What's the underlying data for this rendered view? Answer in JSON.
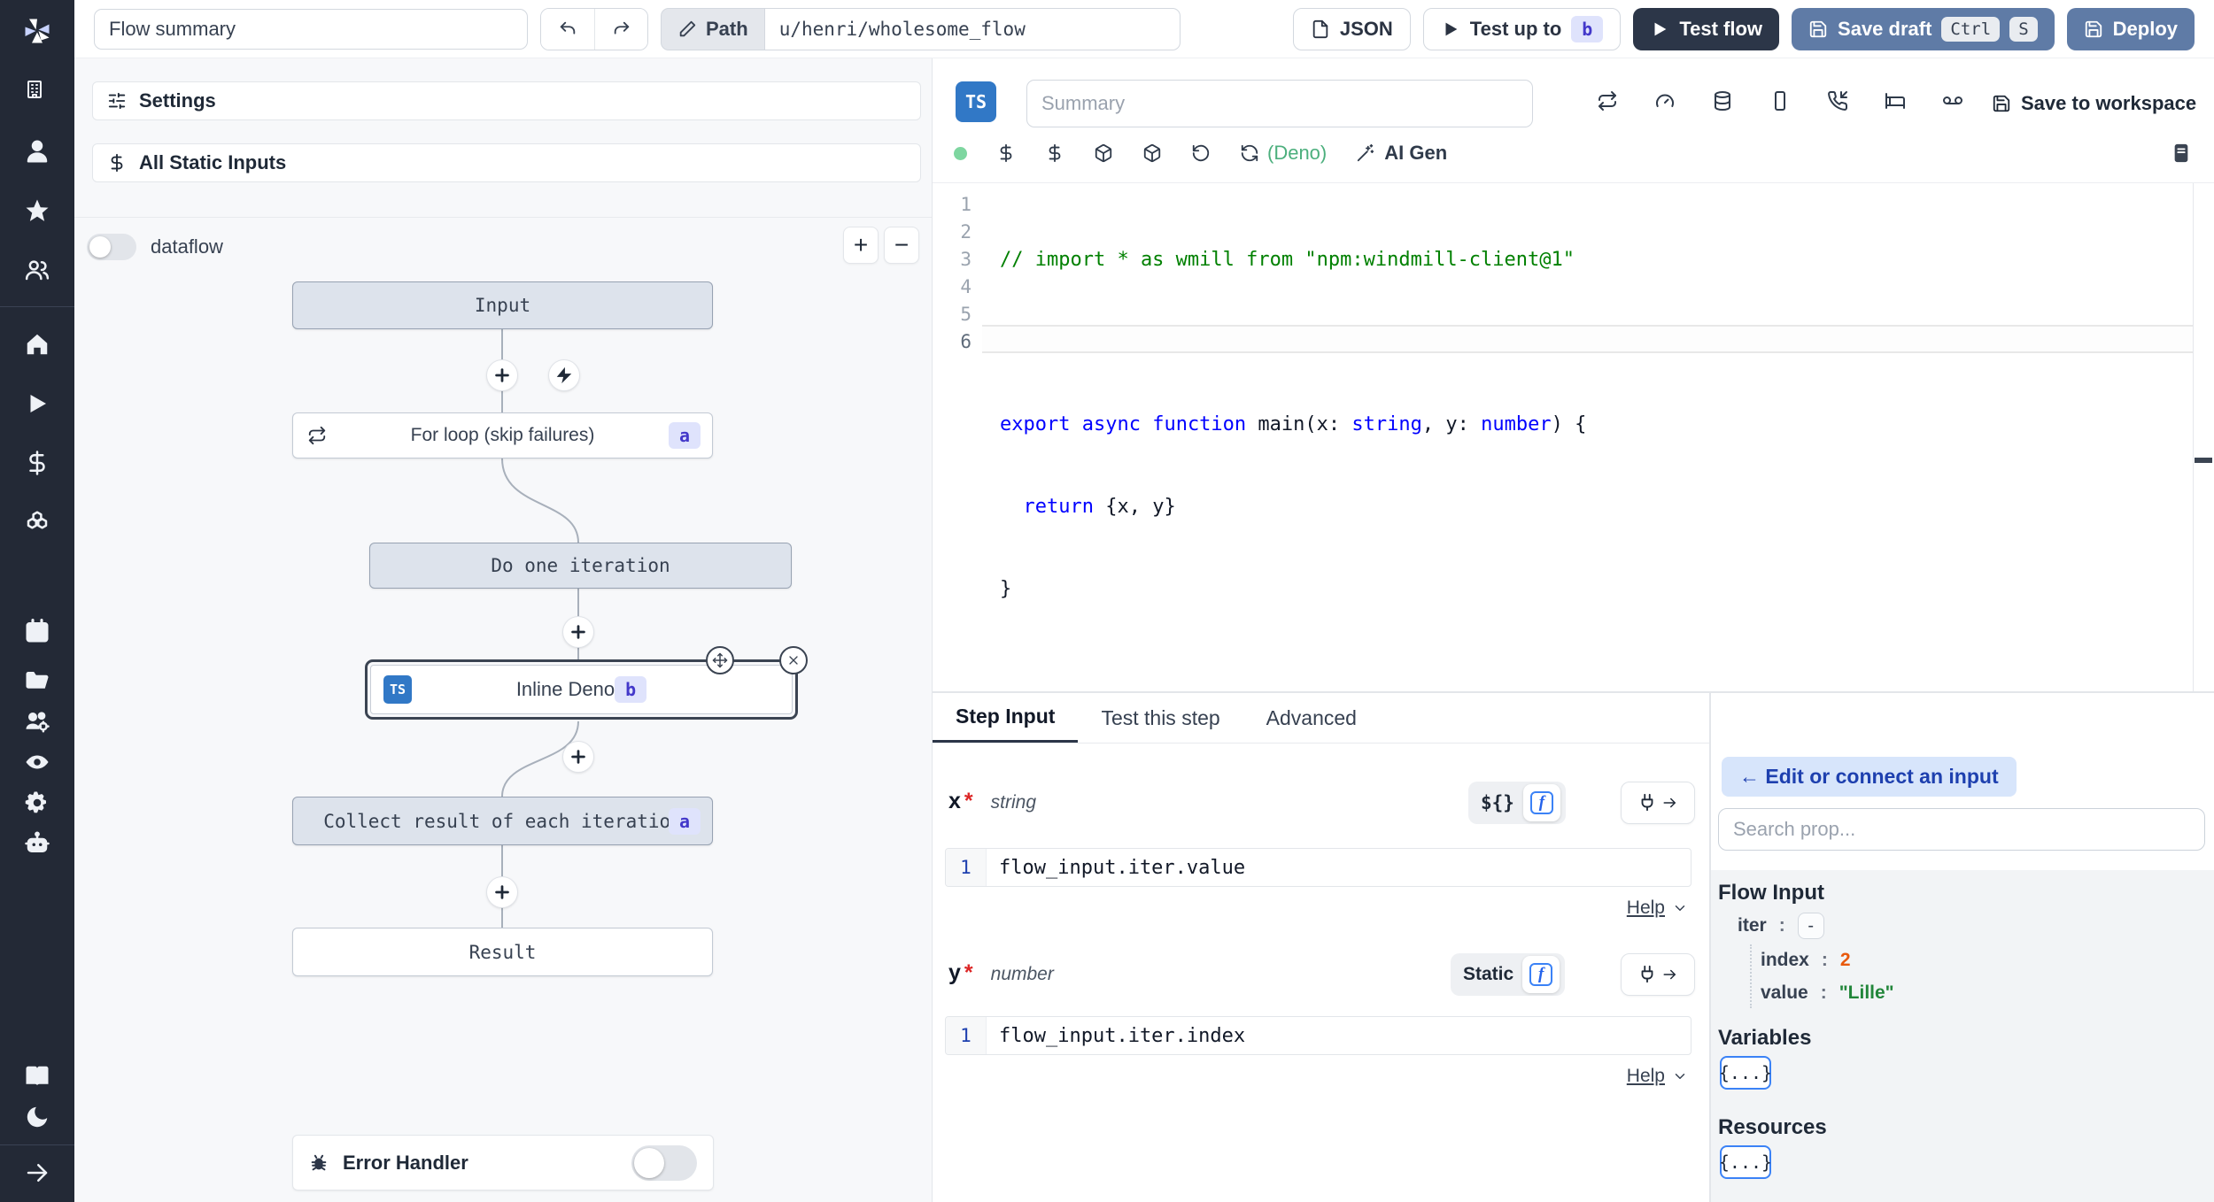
{
  "colors": {
    "sidebar_bg": "#232936",
    "action_blue": "#5f7ba6",
    "primary_dark": "#2c3648",
    "ts_blue": "#3178c6",
    "badge_bg": "#dfe3fc",
    "badge_text": "#4338ca",
    "node_gray_bg": "#dde3ec",
    "chip_blue_bg": "#d7e5fb",
    "link_blue": "#1e40af",
    "comment_green": "#008000",
    "keyword_blue": "#0000ff",
    "runtime_green": "#4caf7d",
    "status_green": "#7ed6a0",
    "index_orange": "#e8590c",
    "string_green": "#22863a"
  },
  "sidebar": {
    "icons": [
      "windmill-logo",
      "building",
      "user",
      "star",
      "user-group",
      "home",
      "play",
      "dollar",
      "boxes",
      "calendar",
      "folder",
      "users-gear",
      "eye",
      "gear",
      "robot",
      "book",
      "moon",
      "arrow-right"
    ]
  },
  "topbar": {
    "flow_summary_value": "Flow summary",
    "path_label": "Path",
    "path_value": "u/henri/wholesome_flow",
    "json_label": "JSON",
    "test_up_to_label": "Test up to",
    "test_up_to_badge": "b",
    "test_flow_label": "Test flow",
    "save_draft_label": "Save draft",
    "save_draft_kbd": [
      "Ctrl",
      "S"
    ],
    "deploy_label": "Deploy"
  },
  "flow_panel": {
    "settings_label": "Settings",
    "static_inputs_label": "All Static Inputs",
    "dataflow_label": "dataflow",
    "zoom_in_label": "+",
    "zoom_out_label": "−",
    "nodes": {
      "input": "Input",
      "for_loop": "For loop (skip failures)",
      "for_loop_badge": "a",
      "do_iteration": "Do one iteration",
      "inline_lang": "TS",
      "inline": "Inline Deno",
      "inline_badge": "b",
      "collect": "Collect result of each iteration",
      "collect_badge": "a",
      "result": "Result"
    },
    "error_handler_label": "Error Handler"
  },
  "editor": {
    "lang_badge": "TS",
    "summary_placeholder": "Summary",
    "save_to_workspace_label": "Save to workspace",
    "runtime_label": "(Deno)",
    "ai_gen_label": "AI Gen",
    "line_numbers": [
      "1",
      "2",
      "3",
      "4",
      "5",
      "6"
    ],
    "code": {
      "line1": "// import * as wmill from \"npm:windmill-client@1\"",
      "line3_kw1": "export ",
      "line3_kw2": "async ",
      "line3_kw3": "function ",
      "line3_fn": "main",
      "line3_p1": "(x: ",
      "line3_t1": "string",
      "line3_p2": ", y: ",
      "line3_t2": "number",
      "line3_p3": ") {",
      "line4_indent": "  ",
      "line4_kw": "return",
      "line4_rest": " {x, y}",
      "line5": "}"
    }
  },
  "step_panel": {
    "tabs": {
      "step_input": "Step Input",
      "test_this_step": "Test this step",
      "advanced": "Advanced"
    },
    "x": {
      "name": "x",
      "required": "*",
      "type": "string",
      "mode_label": "${}",
      "fn_label": "f",
      "line_no": "1",
      "expr": "flow_input.iter.value",
      "help_label": "Help"
    },
    "y": {
      "name": "y",
      "required": "*",
      "type": "number",
      "mode_label": "Static",
      "fn_label": "f",
      "line_no": "1",
      "expr": "flow_input.iter.index",
      "help_label": "Help"
    }
  },
  "connect_panel": {
    "back_label": "← Edit or connect an input",
    "search_placeholder": "Search prop...",
    "flow_input_title": "Flow Input",
    "tree": {
      "iter_key": "iter",
      "colon": ":",
      "iter_toggle": "-",
      "index_key": "index",
      "index_value": "2",
      "value_key": "value",
      "value_value": "\"Lille\""
    },
    "variables_title": "Variables",
    "variables_button": "{...}",
    "resources_title": "Resources",
    "resources_button": "{...}"
  }
}
